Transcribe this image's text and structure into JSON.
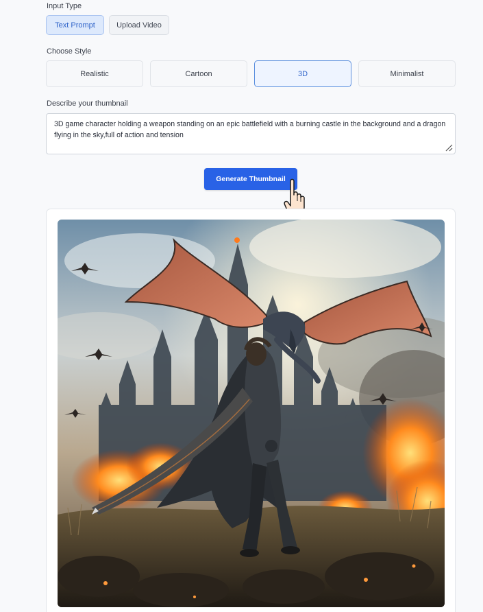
{
  "input_type": {
    "label": "Input Type",
    "options": [
      "Text Prompt",
      "Upload Video"
    ],
    "selected": "Text Prompt"
  },
  "style": {
    "label": "Choose Style",
    "options": [
      "Realistic",
      "Cartoon",
      "3D",
      "Minimalist"
    ],
    "selected": "3D"
  },
  "description": {
    "label": "Describe your thumbnail",
    "value": "3D game character holding a weapon standing on an epic battlefield with a burning castle in the background and a dragon flying in the sky,full of action and tension"
  },
  "generate_button": "Generate Thumbnail",
  "colors": {
    "accent": "#2962e6",
    "selected_bg": "#dde9fc",
    "selected_text": "#2f63c9"
  },
  "icons": [
    "hand-pointer-icon",
    "resize-grip-icon"
  ]
}
